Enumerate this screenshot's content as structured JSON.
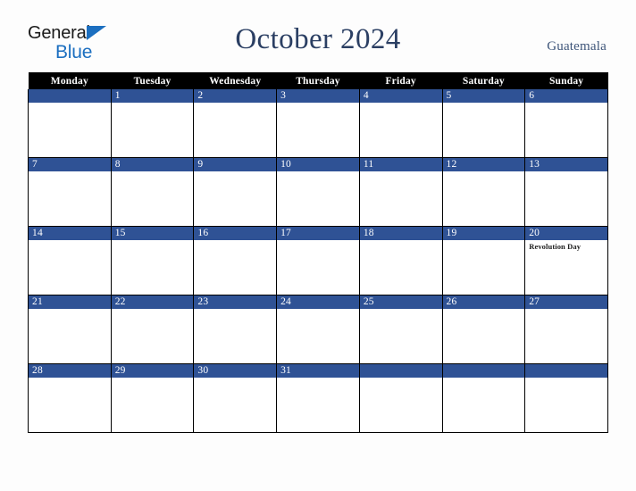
{
  "brand": {
    "name_part1": "General",
    "name_part2": "Blue",
    "color_primary": "#1c6fc0",
    "color_text": "#1a1a1a"
  },
  "header": {
    "title": "October 2024",
    "region": "Guatemala",
    "title_color": "#2b3f63"
  },
  "calendar": {
    "weekday_headers": [
      "Monday",
      "Tuesday",
      "Wednesday",
      "Thursday",
      "Friday",
      "Saturday",
      "Sunday"
    ],
    "header_bg": "#000000",
    "header_text": "#ffffff",
    "daynum_bg": "#2f5295",
    "daynum_text": "#ffffff",
    "cell_bg": "#ffffff",
    "grid_border": "#000000",
    "weeks": [
      [
        {
          "day": "",
          "events": []
        },
        {
          "day": "1",
          "events": []
        },
        {
          "day": "2",
          "events": []
        },
        {
          "day": "3",
          "events": []
        },
        {
          "day": "4",
          "events": []
        },
        {
          "day": "5",
          "events": []
        },
        {
          "day": "6",
          "events": []
        }
      ],
      [
        {
          "day": "7",
          "events": []
        },
        {
          "day": "8",
          "events": []
        },
        {
          "day": "9",
          "events": []
        },
        {
          "day": "10",
          "events": []
        },
        {
          "day": "11",
          "events": []
        },
        {
          "day": "12",
          "events": []
        },
        {
          "day": "13",
          "events": []
        }
      ],
      [
        {
          "day": "14",
          "events": []
        },
        {
          "day": "15",
          "events": []
        },
        {
          "day": "16",
          "events": []
        },
        {
          "day": "17",
          "events": []
        },
        {
          "day": "18",
          "events": []
        },
        {
          "day": "19",
          "events": []
        },
        {
          "day": "20",
          "events": [
            "Revolution Day"
          ]
        }
      ],
      [
        {
          "day": "21",
          "events": []
        },
        {
          "day": "22",
          "events": []
        },
        {
          "day": "23",
          "events": []
        },
        {
          "day": "24",
          "events": []
        },
        {
          "day": "25",
          "events": []
        },
        {
          "day": "26",
          "events": []
        },
        {
          "day": "27",
          "events": []
        }
      ],
      [
        {
          "day": "28",
          "events": []
        },
        {
          "day": "29",
          "events": []
        },
        {
          "day": "30",
          "events": []
        },
        {
          "day": "31",
          "events": []
        },
        {
          "day": "",
          "events": []
        },
        {
          "day": "",
          "events": []
        },
        {
          "day": "",
          "events": []
        }
      ]
    ]
  }
}
